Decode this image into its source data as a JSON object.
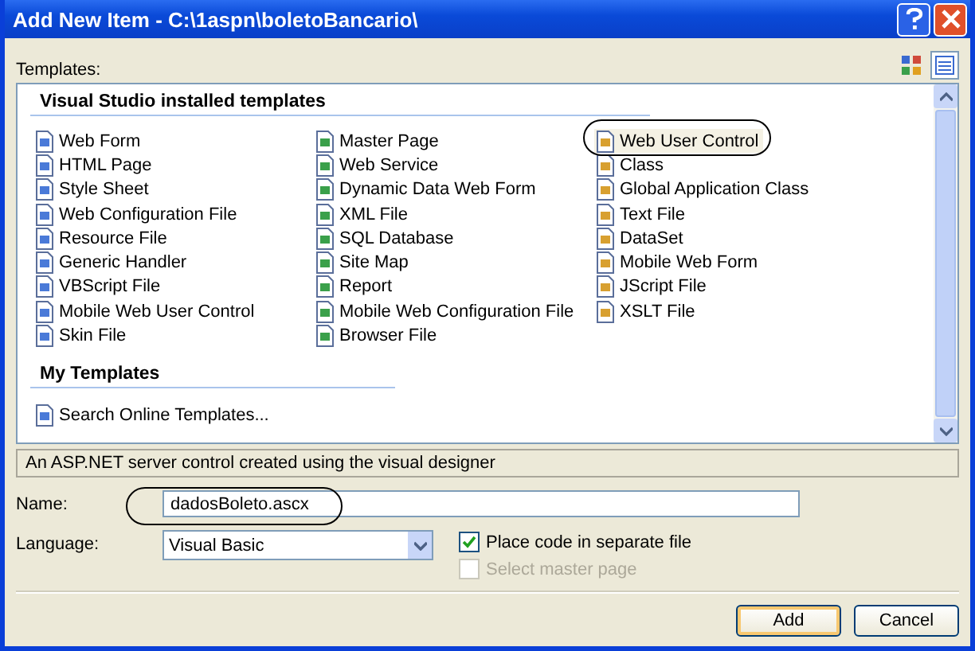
{
  "window": {
    "title": "Add New Item - C:\\1aspn\\boletoBancario\\"
  },
  "templates_label": "Templates:",
  "view_buttons": [
    {
      "kind": "large",
      "selected": false
    },
    {
      "kind": "small",
      "selected": true
    }
  ],
  "groups": [
    {
      "heading": "Visual Studio installed templates",
      "columns": [
        [
          {
            "label": "Web Form",
            "selected": false
          },
          {
            "label": "HTML Page",
            "selected": false
          },
          {
            "label": "Style Sheet",
            "selected": false
          },
          {
            "label": "Web Configuration File",
            "selected": false
          },
          {
            "label": "Resource File",
            "selected": false
          },
          {
            "label": "Generic Handler",
            "selected": false
          },
          {
            "label": "VBScript File",
            "selected": false
          },
          {
            "label": "Mobile Web User Control",
            "selected": false
          },
          {
            "label": "Skin File",
            "selected": false
          }
        ],
        [
          {
            "label": "Master Page",
            "selected": false
          },
          {
            "label": "Web Service",
            "selected": false
          },
          {
            "label": "Dynamic Data Web Form",
            "selected": false
          },
          {
            "label": "XML File",
            "selected": false
          },
          {
            "label": "SQL Database",
            "selected": false
          },
          {
            "label": "Site Map",
            "selected": false
          },
          {
            "label": "Report",
            "selected": false
          },
          {
            "label": "Mobile Web Configuration File",
            "selected": false
          },
          {
            "label": "Browser File",
            "selected": false
          }
        ],
        [
          {
            "label": "Web User Control",
            "selected": true
          },
          {
            "label": "Class",
            "selected": false
          },
          {
            "label": "Global Application Class",
            "selected": false
          },
          {
            "label": "Text File",
            "selected": false
          },
          {
            "label": "DataSet",
            "selected": false
          },
          {
            "label": "Mobile Web Form",
            "selected": false
          },
          {
            "label": "JScript File",
            "selected": false
          },
          {
            "label": "XSLT File",
            "selected": false
          }
        ]
      ]
    },
    {
      "heading": "My Templates",
      "columns": [
        [
          {
            "label": "Search Online Templates...",
            "selected": false
          }
        ]
      ]
    }
  ],
  "description": "An ASP.NET server control created using the visual designer",
  "name_label": "Name:",
  "name_value": "dadosBoleto.ascx",
  "language_label": "Language:",
  "language_value": "Visual Basic",
  "options": [
    {
      "label": "Place code in separate file",
      "checked": true,
      "disabled": false
    },
    {
      "label": "Select master page",
      "checked": false,
      "disabled": true
    }
  ],
  "buttons": [
    "Add",
    "Cancel"
  ]
}
